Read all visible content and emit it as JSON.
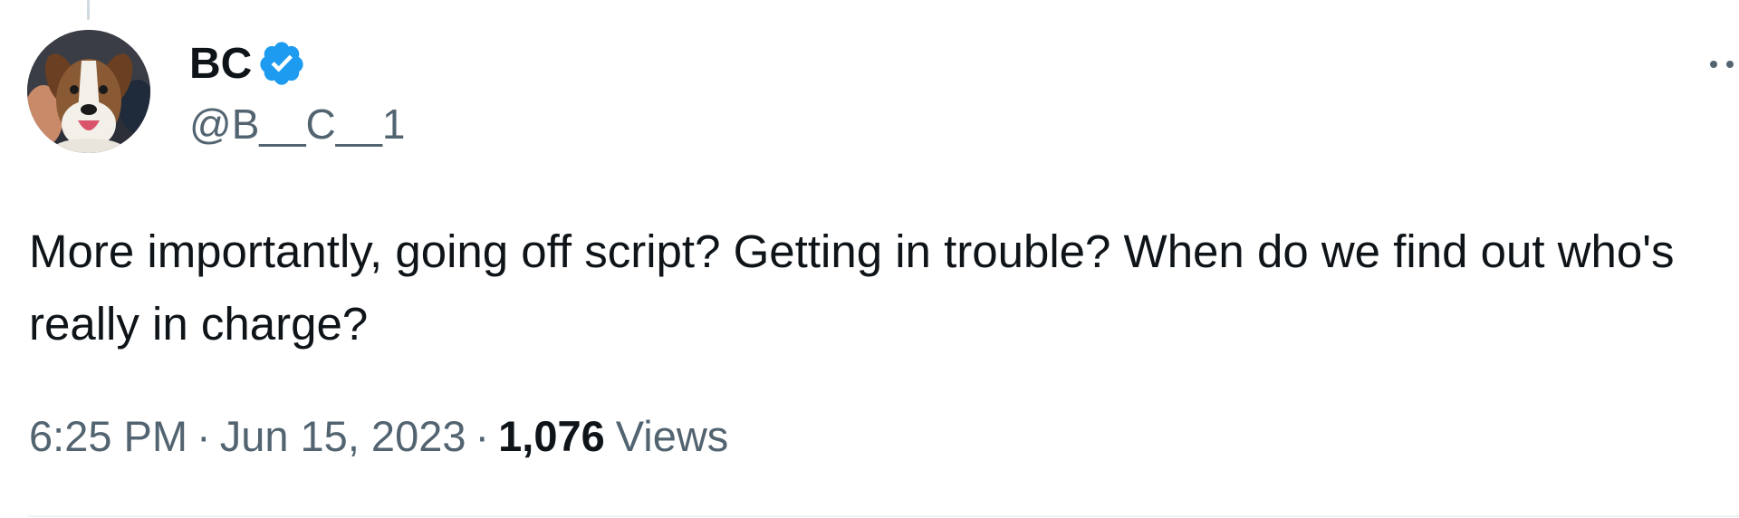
{
  "author": {
    "display_name": "BC",
    "handle": "@B__C__1",
    "verified": true,
    "avatar_icon": "dog-avatar"
  },
  "tweet": {
    "text": "More importantly, going off script? Getting in trouble? When do we find out who's really in charge?"
  },
  "meta": {
    "time": "6:25 PM",
    "separator": "·",
    "date": "Jun 15, 2023",
    "views_count": "1,076",
    "views_label": "Views"
  },
  "colors": {
    "verified_badge": "#1d9bf0",
    "secondary_text": "#536471",
    "primary_text": "#0f1419"
  }
}
